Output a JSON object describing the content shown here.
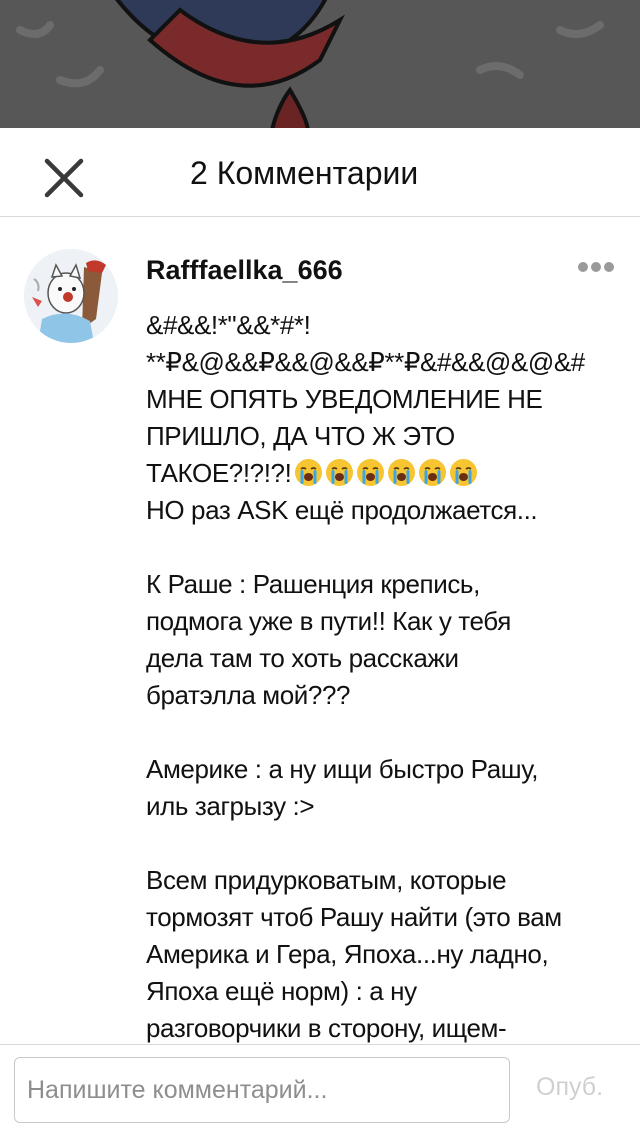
{
  "header": {
    "title": "2 Комментарии",
    "close_icon": "close-icon"
  },
  "comment": {
    "username": "Rafffaellka_666",
    "avatar_icon": "avatar",
    "more_icon": "more-horizontal-icon",
    "lines": [
      "&#&&!*\"&&*#*!",
      "**₽&@&&₽&&@&&₽**₽&#&&@&@&#",
      "МНЕ ОПЯТЬ УВЕДОМЛЕНИЕ НЕ",
      "ПРИШЛО, ДА ЧТО Ж ЭТО",
      "ТАКОЕ?!?!?!",
      "НО раз ASK ещё продолжается...",
      "",
      "К Раше : Рашенция крепись,",
      "подмога уже в пути!! Как у тебя",
      "дела там то хоть расскажи",
      "братэлла мой???",
      "",
      "Америке : а ну ищи быстро Рашу,",
      "иль загрызу :>",
      "",
      "Всем придурковатым, которые",
      "тормозят чтоб Рашу найти (это вам",
      "Америка и Гера, Япоха...ну ладно,",
      "Япоха ещё норм) : а ну",
      "разговорчики в сторону, ищем-",
      ",,,,,,,,,"
    ],
    "emoji_icon": "loudly-crying-face-icon",
    "emoji_count": 6
  },
  "input_bar": {
    "placeholder": "Напишите комментарий...",
    "publish_label": "Опуб."
  },
  "colors": {
    "divider": "#d9d9d9",
    "publish_disabled": "#d0d0d0",
    "username": "#111111"
  }
}
